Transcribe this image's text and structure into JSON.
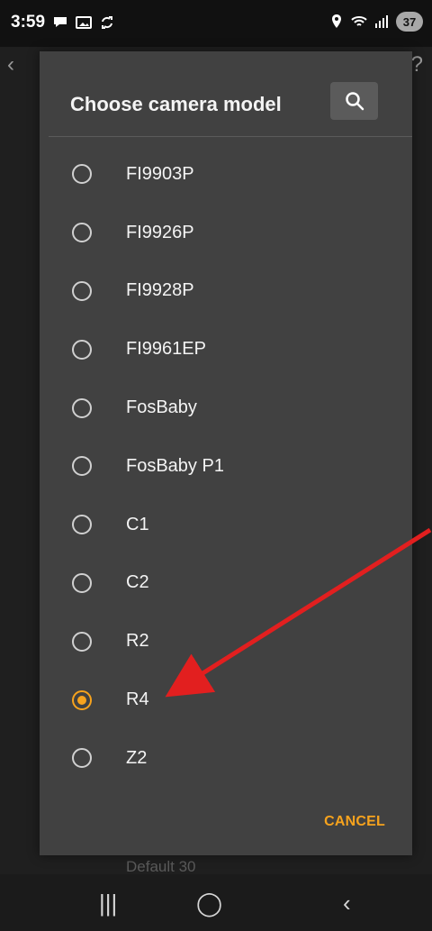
{
  "status_bar": {
    "time": "3:59",
    "battery_level": "37"
  },
  "background": {
    "left_icon": "‹",
    "right_icon": "?",
    "bottom_text": "Default 30"
  },
  "dialog": {
    "title": "Choose camera model",
    "search_icon": "search-icon",
    "options": [
      {
        "label": "FI9903P",
        "selected": false
      },
      {
        "label": "FI9926P",
        "selected": false
      },
      {
        "label": "FI9928P",
        "selected": false
      },
      {
        "label": "FI9961EP",
        "selected": false
      },
      {
        "label": "FosBaby",
        "selected": false
      },
      {
        "label": "FosBaby P1",
        "selected": false
      },
      {
        "label": "C1",
        "selected": false
      },
      {
        "label": "C2",
        "selected": false
      },
      {
        "label": "R2",
        "selected": false
      },
      {
        "label": "R4",
        "selected": true
      },
      {
        "label": "Z2",
        "selected": false
      }
    ],
    "cancel_label": "CANCEL"
  },
  "nav": {
    "recent_apps": "|||",
    "home": "◯",
    "back": "‹"
  },
  "colors": {
    "accent": "#f7a31d",
    "annotation": "#e21f1f"
  }
}
